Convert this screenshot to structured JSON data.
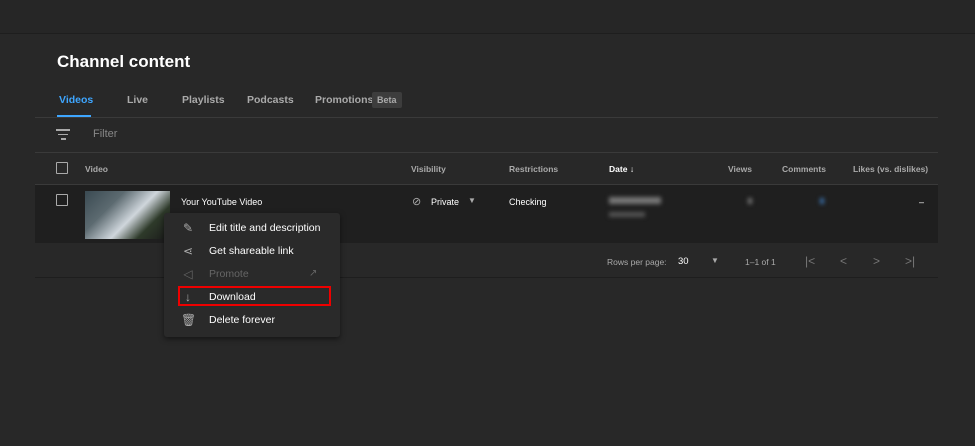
{
  "page": {
    "title": "Channel content"
  },
  "tabs": [
    {
      "label": "Videos",
      "active": true
    },
    {
      "label": "Live"
    },
    {
      "label": "Playlists"
    },
    {
      "label": "Podcasts"
    },
    {
      "label": "Promotions",
      "badge": "Beta"
    }
  ],
  "filter": {
    "placeholder": "Filter"
  },
  "columns": [
    "Video",
    "Visibility",
    "Restrictions",
    "Date",
    "Views",
    "Comments",
    "Likes (vs. dislikes)"
  ],
  "row": {
    "title": "Your YouTube Video",
    "visibility": "Private",
    "restrictions": "Checking",
    "likes": "–"
  },
  "pagination": {
    "rows_label": "Rows per page:",
    "rows_value": "30",
    "range": "1–1 of 1"
  },
  "menu": [
    {
      "label": "Edit title and description",
      "icon": "pencil-icon"
    },
    {
      "label": "Get shareable link",
      "icon": "share-icon"
    },
    {
      "label": "Promote",
      "icon": "megaphone-icon",
      "disabled": true
    },
    {
      "label": "Download",
      "icon": "download-icon",
      "highlighted": true
    },
    {
      "label": "Delete forever",
      "icon": "trash-icon"
    }
  ],
  "colors": {
    "accent": "#3ea6ff",
    "highlight": "#e00000",
    "background": "#282828"
  }
}
